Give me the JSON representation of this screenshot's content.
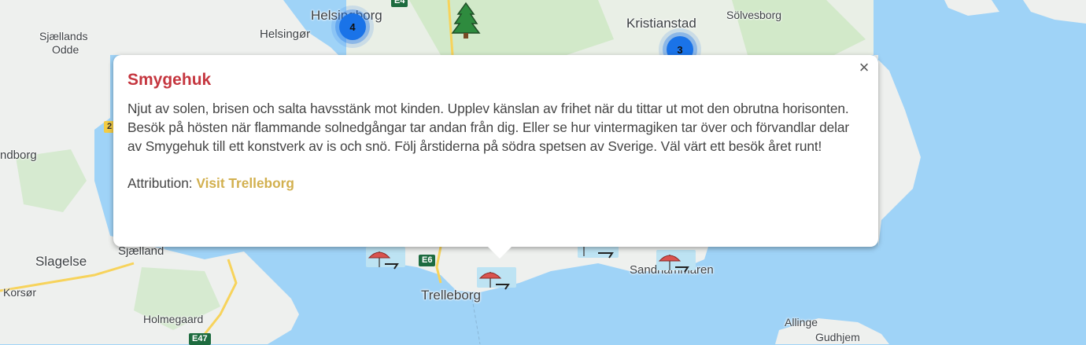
{
  "popup": {
    "title": "Smygehuk",
    "description": "Njut av solen, brisen och salta havsstänk mot kinden. Upplev känslan av frihet när du tittar ut mot den obrutna horisonten. Besök på hösten när flammande solnedgångar tar andan från dig. Eller se hur vintermagiken tar över och förvandlar delar av Smygehuk till ett konstverk av is och snö. Följ årstiderna på södra spetsen av Sverige. Väl värt ett besök året runt!",
    "attribution_label": "Attribution:",
    "attribution_link": "Visit Trelleborg",
    "close_symbol": "×"
  },
  "map": {
    "places": {
      "helsingborg": "Helsingborg",
      "helsingor": "Helsingør",
      "kristianstad": "Kristianstad",
      "solvesborg": "Sölvesborg",
      "sjaellands_odde_1": "Sjællands",
      "sjaellands_odde_2": "Odde",
      "kalundborg": "ndborg",
      "slagelse": "Slagelse",
      "sjaelland": "Sjælland",
      "korsor": "Korsør",
      "holmegaard": "Holmegaard",
      "trelleborg": "Trelleborg",
      "sandhammaren": "Sandhammaren",
      "allinge": "Allinge",
      "gudhjem": "Gudhjem"
    },
    "roads": {
      "e6": "E6",
      "e47": "E47",
      "r2": "2",
      "e4": "E4"
    },
    "clusters": {
      "helsingborg_count": "4",
      "kristianstad_count": "3"
    },
    "colors": {
      "water": "#9fd3f7",
      "land": "#f1f3f4",
      "forest": "#cfe8c4",
      "cluster": "#1a73e8",
      "title": "#c5363f",
      "link": "#d2b04f"
    }
  }
}
